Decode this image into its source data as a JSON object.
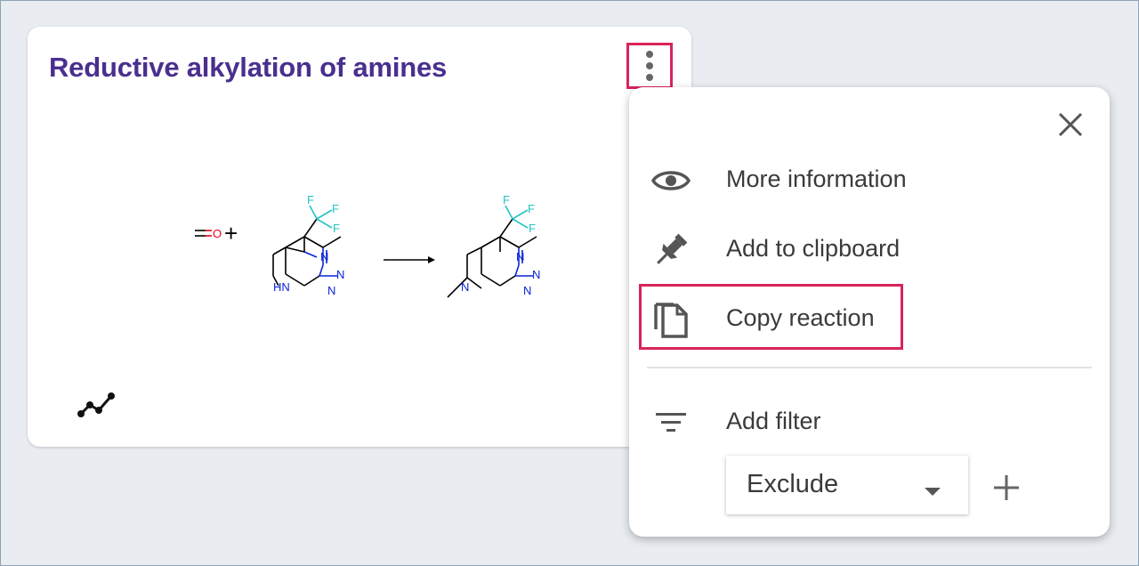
{
  "card": {
    "title": "Reductive alkylation of amines",
    "title_color": "#4a2f8e"
  },
  "scheme": {
    "plus": "+",
    "oxygen": "O",
    "fluorine": "F",
    "nitrogen": "N",
    "nh": "HN",
    "colors": {
      "oxygen": "#e8001c",
      "nitrogen": "#0a24d6",
      "fluorine": "#23c3c3",
      "bond": "#000000"
    }
  },
  "menu": {
    "items": [
      {
        "label": "More information",
        "icon": "eye-icon"
      },
      {
        "label": "Add to clipboard",
        "icon": "pin-icon"
      },
      {
        "label": "Copy reaction",
        "icon": "copy-icon"
      },
      {
        "label": "Add filter",
        "icon": "filter-icon"
      }
    ],
    "filter_select": {
      "value": "Exclude"
    },
    "highlight_color": "#d8245a"
  }
}
